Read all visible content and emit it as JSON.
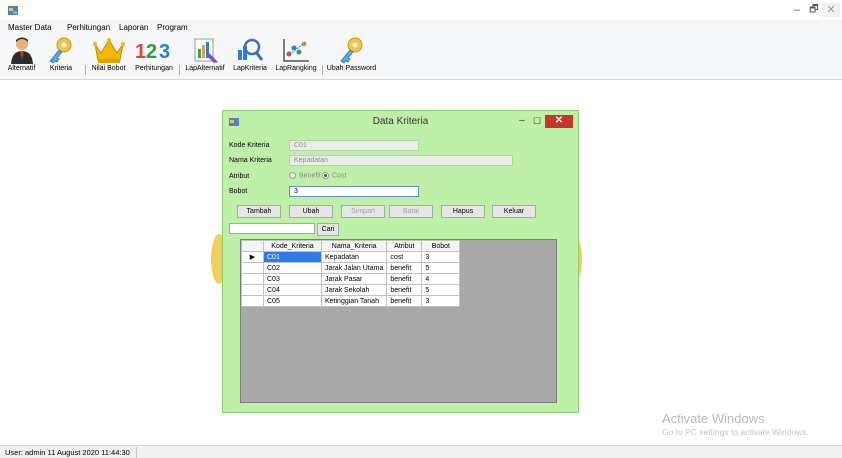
{
  "menu": [
    "Master Data",
    "Perhitungan",
    "Laporan",
    "Program"
  ],
  "toolbar": [
    {
      "label": "Alternatif",
      "icon": "user-icon"
    },
    {
      "label": "Kriteria",
      "icon": "key-icon"
    },
    {
      "label": "Nilai Bobot",
      "icon": "crown-icon"
    },
    {
      "label": "Perhitungan",
      "icon": "numbers-icon"
    },
    {
      "label": "LapAlternatif",
      "icon": "report-icon"
    },
    {
      "label": "LapKriteria",
      "icon": "magnifier-chart-icon"
    },
    {
      "label": "LapRangking",
      "icon": "scatter-chart-icon"
    },
    {
      "label": "Ubah Password",
      "icon": "key-icon"
    }
  ],
  "window_controls": {
    "minimize": "–",
    "maximize": "🗗",
    "close": "✕"
  },
  "dialog": {
    "title": "Data Kriteria",
    "controls": {
      "minimize": "–",
      "maximize": "☐",
      "close": "✕"
    },
    "labels": {
      "kode": "Kode Kriteria",
      "nama": "Nama Kriteria",
      "atribut": "Atribut",
      "bobot": "Bobot"
    },
    "fields": {
      "kode": "C01",
      "nama": "Kepadatan",
      "bobot": "3"
    },
    "radio": {
      "benefit": "Benefit",
      "cost": "Cost",
      "selected": "Cost"
    },
    "buttons": [
      "Tambah",
      "Ubah",
      "Simpan",
      "Batal",
      "Hapus",
      "Keluar"
    ],
    "search": {
      "value": "",
      "button": "Cari"
    },
    "table": {
      "columns": [
        "Kode_Kriteria",
        "Nama_Kriteria",
        "Atribut",
        "Bobot"
      ],
      "rows": [
        [
          "C01",
          "Kepadatan",
          "cost",
          "3"
        ],
        [
          "C02",
          "Jarak Jalan Utama",
          "benefit",
          "5"
        ],
        [
          "C03",
          "Jarak Pasar",
          "benefit",
          "4"
        ],
        [
          "C04",
          "Jarak Sekolah",
          "benefit",
          "5"
        ],
        [
          "C05",
          "Ketinggian Tanah",
          "benefit",
          "3"
        ]
      ],
      "current_row_marker": "▶"
    }
  },
  "watermark": {
    "title": "Activate Windows",
    "subtitle": "Go to PC settings to activate Windows."
  },
  "status": "User: admin  11 August 2020 11:44:30",
  "colors": {
    "dialog_bg": "#bff0a8",
    "selection": "#2d7bea",
    "close_button": "#c7362b"
  }
}
